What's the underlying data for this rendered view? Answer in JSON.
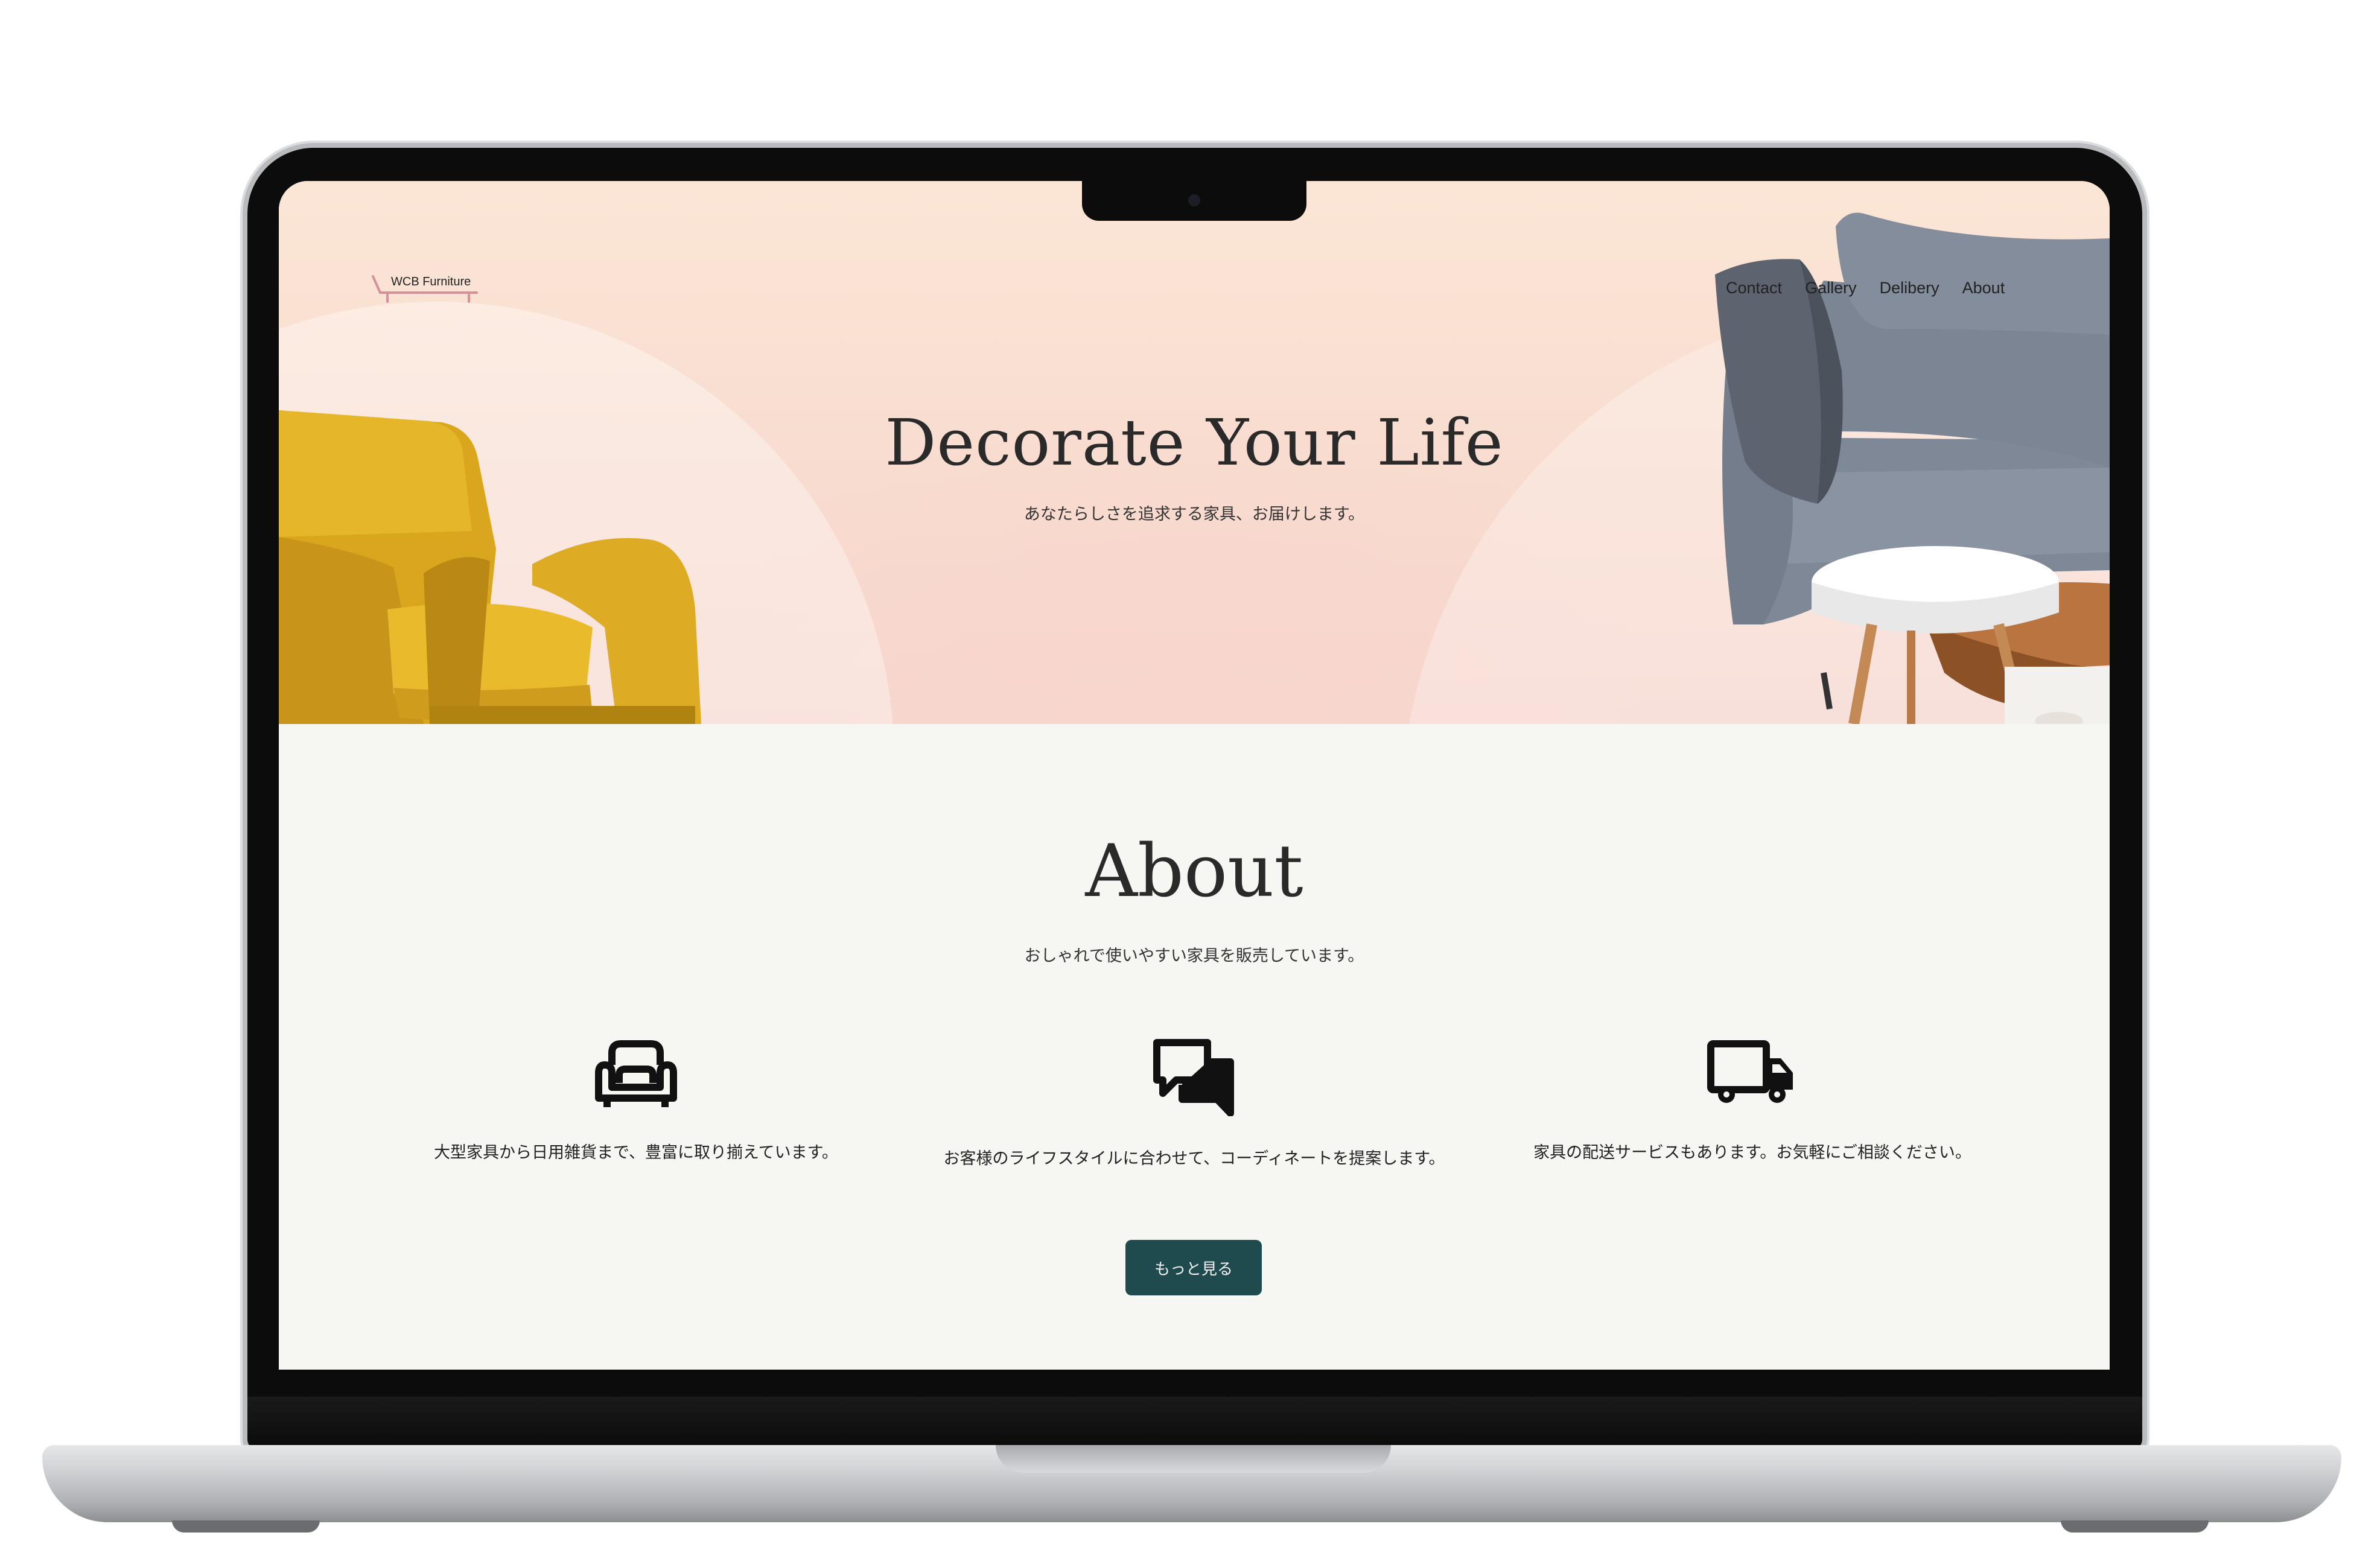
{
  "site": {
    "logo_text": "WCB Furniture",
    "accent_color": "#1f4b4f",
    "logo_color": "#d78f9a"
  },
  "nav": {
    "items": [
      {
        "label": "Contact"
      },
      {
        "label": "Gallery"
      },
      {
        "label": "Delibery"
      },
      {
        "label": "About"
      }
    ]
  },
  "hero": {
    "title": "Decorate Your Life",
    "subtitle": "あなたらしさを追求する家具、お届けします。"
  },
  "about": {
    "title": "About",
    "subtitle": "おしゃれで使いやすい家具を販売しています。",
    "features": [
      {
        "icon": "sofa-icon",
        "text": "大型家具から日用雑貨まで、豊富に取り揃えています。"
      },
      {
        "icon": "chat-icon",
        "text": "お客様のライフスタイルに合わせて、コーディネートを提案します。"
      },
      {
        "icon": "truck-icon",
        "text": "家具の配送サービスもあります。お気軽にご相談ください。"
      }
    ],
    "more_button": "もっと見る"
  }
}
